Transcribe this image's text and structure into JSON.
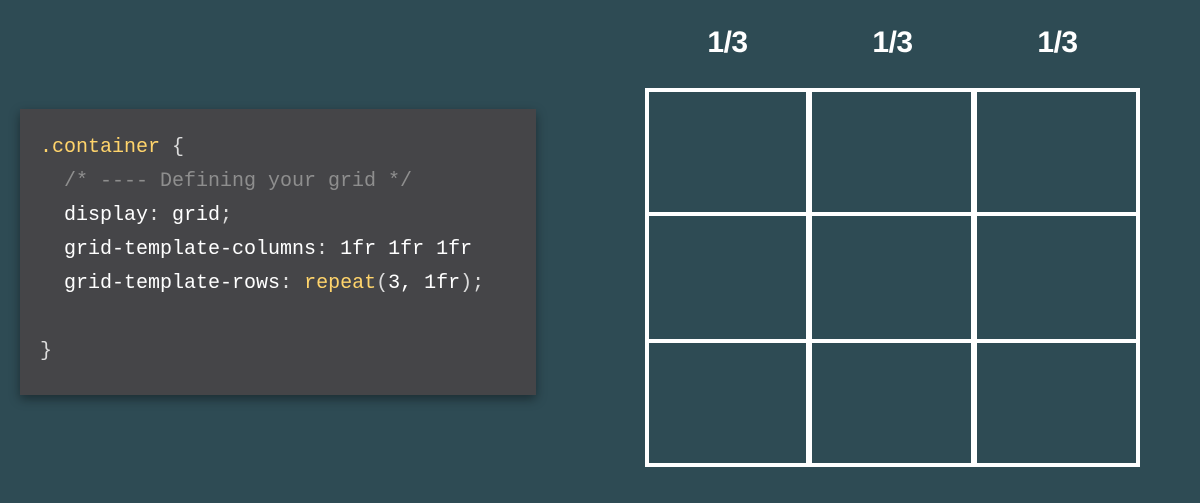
{
  "code": {
    "lines": [
      {
        "tokens": [
          {
            "cls": "tok-selector",
            "t": ".container"
          },
          {
            "cls": "tok-brace",
            "t": " {"
          }
        ]
      },
      {
        "tokens": [
          {
            "cls": "tok-comment",
            "t": "  /* ---- Defining your grid */"
          }
        ]
      },
      {
        "tokens": [
          {
            "cls": "tok-prop",
            "t": "  display"
          },
          {
            "cls": "tok-brace",
            "t": ": "
          },
          {
            "cls": "tok-value",
            "t": "grid"
          },
          {
            "cls": "tok-brace",
            "t": ";"
          }
        ]
      },
      {
        "tokens": [
          {
            "cls": "tok-prop",
            "t": "  grid-template-columns"
          },
          {
            "cls": "tok-brace",
            "t": ": "
          },
          {
            "cls": "tok-value",
            "t": "1fr 1fr 1fr"
          }
        ]
      },
      {
        "tokens": [
          {
            "cls": "tok-prop",
            "t": "  grid-template-rows"
          },
          {
            "cls": "tok-brace",
            "t": ": "
          },
          {
            "cls": "tok-fn",
            "t": "repeat"
          },
          {
            "cls": "tok-brace",
            "t": "("
          },
          {
            "cls": "tok-value",
            "t": "3, 1fr"
          },
          {
            "cls": "tok-brace",
            "t": ");"
          }
        ]
      },
      {
        "tokens": [
          {
            "cls": "",
            "t": " "
          }
        ]
      },
      {
        "tokens": [
          {
            "cls": "tok-brace",
            "t": "}"
          }
        ]
      }
    ]
  },
  "diagram": {
    "column_labels": [
      "1/3",
      "1/3",
      "1/3"
    ],
    "rows": 3,
    "cols": 3
  }
}
